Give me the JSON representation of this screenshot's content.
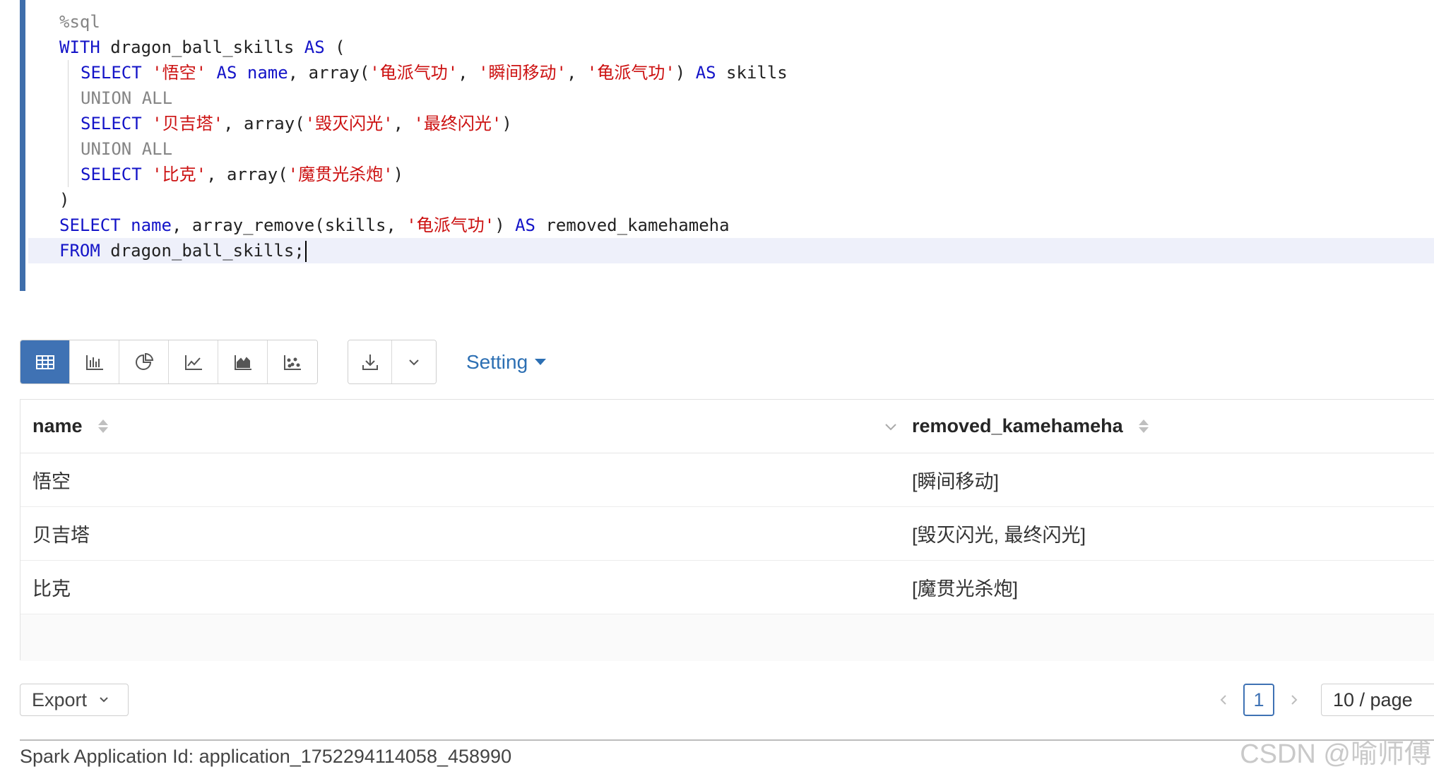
{
  "editor": {
    "magic": "%sql",
    "cte_name": "dragon_ball_skills",
    "rows": [
      {
        "name": "悟空",
        "skills": [
          "龟派气功",
          "瞬间移动",
          "龟派气功"
        ]
      },
      {
        "name": "贝吉塔",
        "skills": [
          "毁灭闪光",
          "最终闪光"
        ]
      },
      {
        "name": "比克",
        "skills": [
          "魔贯光杀炮"
        ]
      }
    ],
    "union": "UNION ALL",
    "select_fn": "array_remove",
    "remove_value": "龟派气功",
    "alias": "removed_kamehameha",
    "from_table": "dragon_ball_skills;"
  },
  "toolbar": {
    "views": [
      {
        "id": "table",
        "icon": "table-icon",
        "active": true
      },
      {
        "id": "bar",
        "icon": "bar-chart-icon",
        "active": false
      },
      {
        "id": "pie",
        "icon": "pie-chart-icon",
        "active": false
      },
      {
        "id": "line",
        "icon": "line-chart-icon",
        "active": false
      },
      {
        "id": "area",
        "icon": "area-chart-icon",
        "active": false
      },
      {
        "id": "scatter",
        "icon": "scatter-chart-icon",
        "active": false
      }
    ],
    "download_icon": "download-icon",
    "dropdown_icon": "chevron-down-icon",
    "setting_label": "Setting"
  },
  "table": {
    "columns": [
      "name",
      "removed_kamehameha"
    ],
    "rows": [
      [
        "悟空",
        "[瞬间移动]"
      ],
      [
        "贝吉塔",
        "[毁灭闪光, 最终闪光]"
      ],
      [
        "比克",
        "[魔贯光杀炮]"
      ]
    ]
  },
  "footer": {
    "export_label": "Export",
    "current_page": "1",
    "page_size": "10 / page",
    "app_id": "Spark Application Id: application_1752294114058_458990",
    "watermark": "CSDN @喻师傅"
  },
  "colors": {
    "accent": "#3f72b4",
    "keyword": "#1414c8",
    "string": "#cc1111",
    "editor_bar": "#3f6eab"
  }
}
